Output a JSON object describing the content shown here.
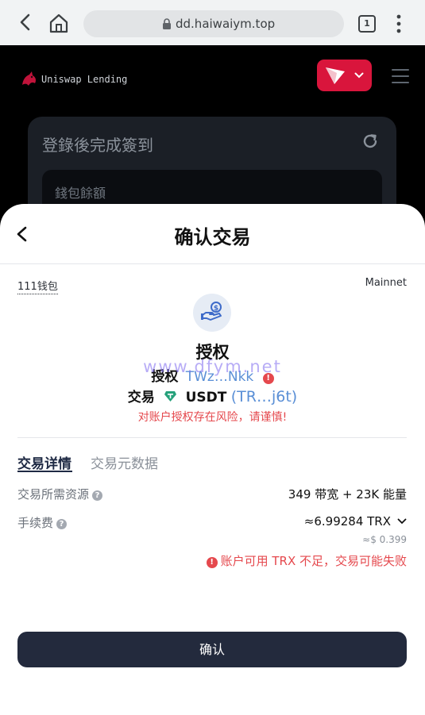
{
  "browser": {
    "url": "dd.haiwaiym.top",
    "tab_count": "1"
  },
  "app": {
    "logo_text": "Uniswap Lending",
    "checkin_title": "登錄後完成簽到",
    "wallet_balance_label": "錢包餘額",
    "brand_color": "#d9153c"
  },
  "sheet": {
    "title": "确认交易",
    "wallet_name": "111钱包",
    "network": "Mainnet",
    "action_title": "授权",
    "authorize": {
      "label": "授权",
      "address": "TWz…Nkk",
      "risk_icon": "!"
    },
    "watermark": "www.dfym.net",
    "trade": {
      "label": "交易",
      "token": "USDT",
      "address": "(TR…j6t)",
      "token_icon": "tether-icon"
    },
    "risk_warning": "对账户授权存在风险，请谨慎!",
    "tabs": {
      "details": "交易详情",
      "metadata": "交易元数据"
    },
    "resources": {
      "label": "交易所需资源",
      "value": "349 带宽 + 23K 能量"
    },
    "fee": {
      "label": "手续费",
      "value": "≈6.99284 TRX",
      "usd": "≈$ 0.399",
      "warning": "账户可用 TRX 不足，交易可能失败"
    },
    "help_icon": "?",
    "confirm_label": "确认",
    "accent_color": "#232a3d",
    "danger_color": "#e5484d",
    "link_color": "#5a8fd6"
  }
}
